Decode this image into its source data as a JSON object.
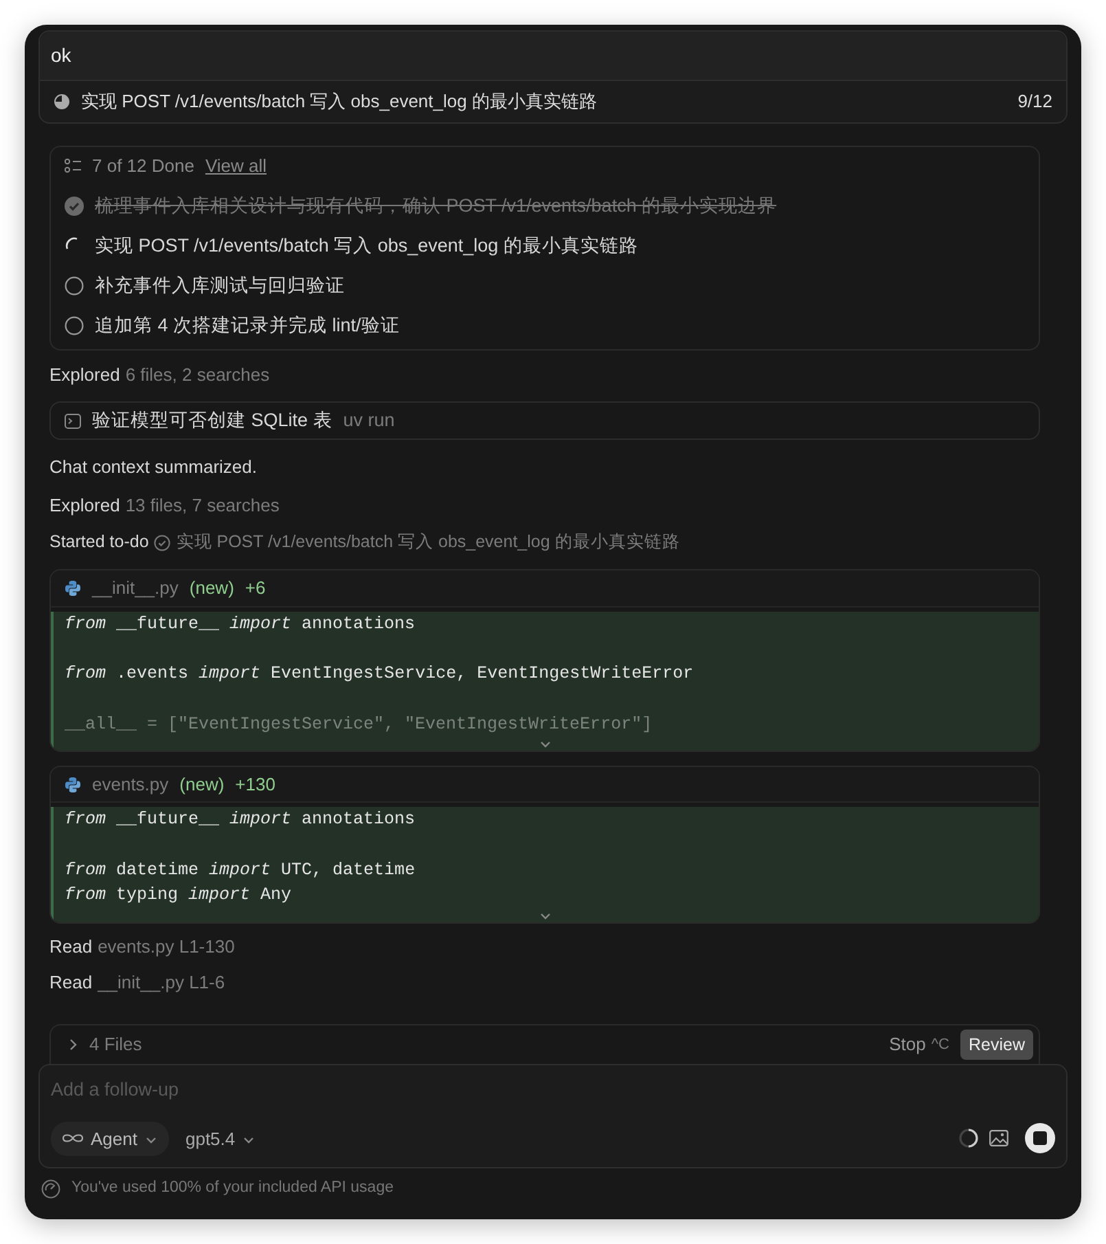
{
  "message": {
    "text": "ok"
  },
  "current_todo": {
    "text": "实现 POST /v1/events/batch 写入 obs_event_log 的最小真实链路",
    "progress": "9/12"
  },
  "todo_panel": {
    "summary": "7 of 12 Done",
    "view_all": "View all",
    "items": [
      {
        "text": "梳理事件入库相关设计与现有代码，确认 POST /v1/events/batch 的最小实现边界",
        "kind": "done"
      },
      {
        "text": "实现 POST /v1/events/batch 写入 obs_event_log 的最小真实链路",
        "kind": "active"
      },
      {
        "text": "补充事件入库测试与回归验证",
        "kind": "pending"
      },
      {
        "text": "追加第 4 次搭建记录并完成 lint/验证",
        "kind": "pending"
      }
    ]
  },
  "activity": [
    {
      "kind": "explored",
      "verb": "Explored",
      "detail": "6 files, 2 searches"
    },
    {
      "kind": "command",
      "title": "验证模型可否创建 SQLite 表",
      "detail": "uv run"
    },
    {
      "kind": "note",
      "text": "Chat context summarized."
    },
    {
      "kind": "explored",
      "verb": "Explored",
      "detail": "13 files, 7 searches"
    },
    {
      "kind": "started",
      "verb": "Started to-do",
      "detail": "实现 POST /v1/events/batch 写入 obs_event_log 的最小真实链路"
    },
    {
      "kind": "diff",
      "file": "__init__.py",
      "tag": "(new)",
      "added": "+6",
      "blocks": [
        [
          "*from* __future__ *import* annotations"
        ],
        [
          "*from* .events *import* EventIngestService, EventIngestWriteError"
        ],
        [
          "__all__ = [\"EventIngestService\", \"EventIngestWriteError\"]"
        ]
      ]
    },
    {
      "kind": "diff",
      "file": "events.py",
      "tag": "(new)",
      "added": "+130",
      "blocks": [
        [
          "*from* __future__ *import* annotations"
        ],
        [
          "*from* datetime *import* UTC, datetime",
          "*from* typing *import* Any"
        ]
      ]
    },
    {
      "kind": "read",
      "verb": "Read",
      "detail": "events.py L1-130"
    },
    {
      "kind": "read",
      "verb": "Read",
      "detail": "__init__.py L1-6"
    }
  ],
  "files_bar": {
    "label": "4 Files",
    "stop": "Stop",
    "shortcut": "^C",
    "review": "Review"
  },
  "composer": {
    "placeholder": "Add a follow-up",
    "mode": "Agent",
    "model": "gpt5.4"
  },
  "usage": {
    "text": "You've used 100% of your included API usage"
  }
}
